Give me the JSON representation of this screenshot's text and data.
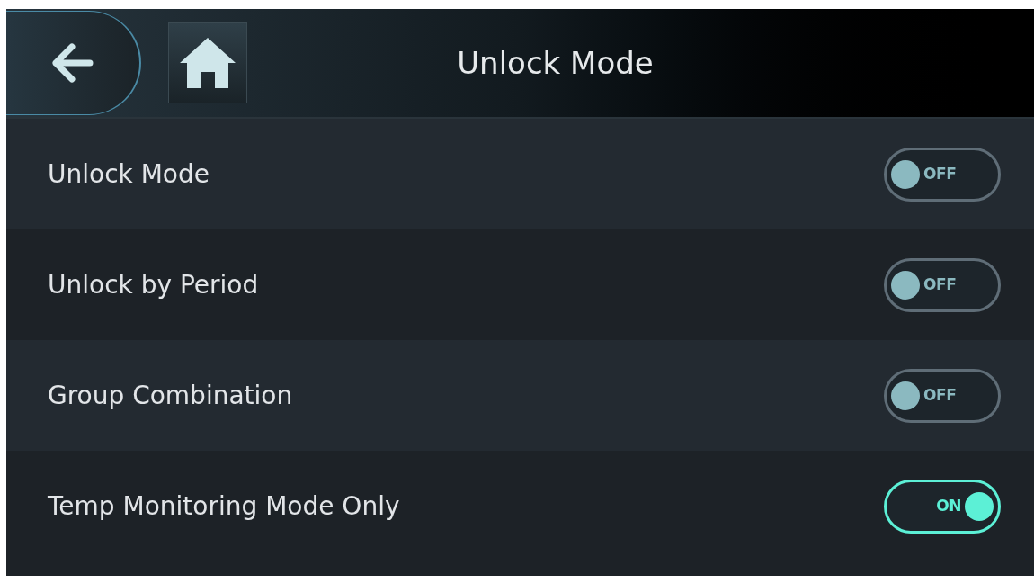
{
  "header": {
    "title": "Unlock Mode"
  },
  "settings": [
    {
      "label": "Unlock Mode",
      "on": false,
      "state_text": "OFF"
    },
    {
      "label": "Unlock by Period",
      "on": false,
      "state_text": "OFF"
    },
    {
      "label": "Group Combination",
      "on": false,
      "state_text": "OFF"
    },
    {
      "label": "Temp Monitoring Mode Only",
      "on": true,
      "state_text": "ON"
    }
  ]
}
